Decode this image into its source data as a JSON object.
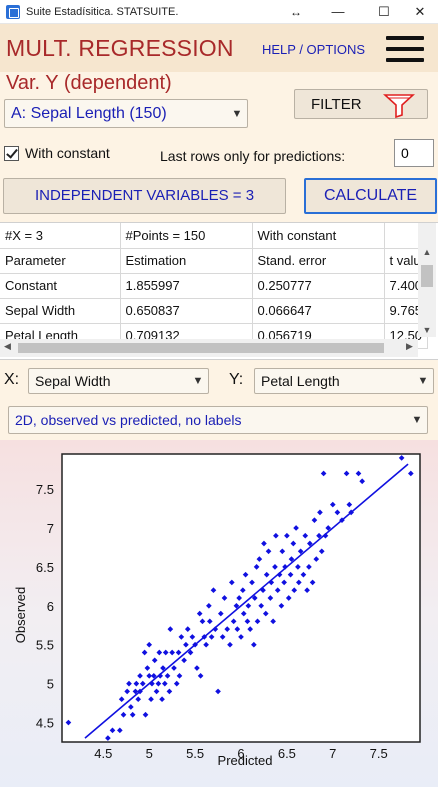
{
  "window": {
    "title": "Suite Estadísitica. STATSUITE.",
    "controls": {
      "resize": "↔",
      "minimize": "—",
      "maximize": "☐",
      "close": "✕"
    }
  },
  "header": {
    "title": "MULT. REGRESSION",
    "help": "HELP / OPTIONS"
  },
  "var_y": {
    "label": "Var. Y (dependent)",
    "selected": "A: Sepal Length (150)"
  },
  "filter_button": "FILTER",
  "with_constant": {
    "label": "With constant",
    "checked": true
  },
  "last_rows": {
    "label": "Last rows only for predictions:",
    "value": "0"
  },
  "independent_button": "INDEPENDENT VARIABLES = 3",
  "calculate_button": "CALCULATE",
  "results_table": {
    "rows": [
      [
        "#X = 3",
        "#Points = 150",
        "With constant",
        ""
      ],
      [
        "Parameter",
        "Estimation",
        "Stand. error",
        "t valu"
      ],
      [
        "Constant",
        "1.855997",
        "0.250777",
        "7.400"
      ],
      [
        "Sepal Width",
        "0.650837",
        "0.066647",
        "9.765"
      ],
      [
        "Petal Length",
        "0.709132",
        "0.056719",
        "12.50"
      ]
    ]
  },
  "x_select": {
    "label": "X:",
    "selected": "Sepal Width"
  },
  "y_select": {
    "label": "Y:",
    "selected": "Petal Length"
  },
  "plot_type": {
    "selected": "2D, observed vs predicted, no labels"
  },
  "colors": {
    "accent_red": "#a8292a",
    "link_blue": "#1a1fb5",
    "point_blue": "#1010e0"
  },
  "icons": [
    "funnel-icon",
    "hamburger-icon",
    "chevron-down-icon",
    "checkbox-checked-icon"
  ],
  "chart_data": {
    "type": "scatter",
    "xlabel": "Predicted",
    "ylabel": "Observed",
    "xlim": [
      4.05,
      7.95
    ],
    "ylim": [
      4.25,
      7.95
    ],
    "xticks": [
      "4.5",
      "5",
      "5.5",
      "6",
      "6.5",
      "7",
      "7.5"
    ],
    "yticks": [
      "4.5",
      "5",
      "5.5",
      "6",
      "6.5",
      "7",
      "7.5"
    ],
    "grid": true,
    "fit_line": {
      "x": [
        4.3,
        7.82
      ],
      "y": [
        4.3,
        7.82
      ]
    },
    "points": [
      [
        4.12,
        4.5
      ],
      [
        4.55,
        4.3
      ],
      [
        4.6,
        4.4
      ],
      [
        4.68,
        4.4
      ],
      [
        4.7,
        4.8
      ],
      [
        4.72,
        4.6
      ],
      [
        4.76,
        4.9
      ],
      [
        4.78,
        5.0
      ],
      [
        4.8,
        4.7
      ],
      [
        4.82,
        4.6
      ],
      [
        4.85,
        4.9
      ],
      [
        4.86,
        5.0
      ],
      [
        4.88,
        4.8
      ],
      [
        4.9,
        5.1
      ],
      [
        4.9,
        4.9
      ],
      [
        4.93,
        5.0
      ],
      [
        4.95,
        5.4
      ],
      [
        4.96,
        4.6
      ],
      [
        4.98,
        5.2
      ],
      [
        5.0,
        5.1
      ],
      [
        5.0,
        5.5
      ],
      [
        5.02,
        4.8
      ],
      [
        5.03,
        5.0
      ],
      [
        5.05,
        5.1
      ],
      [
        5.06,
        5.3
      ],
      [
        5.08,
        4.9
      ],
      [
        5.1,
        5.0
      ],
      [
        5.11,
        5.4
      ],
      [
        5.12,
        5.1
      ],
      [
        5.14,
        4.8
      ],
      [
        5.15,
        5.2
      ],
      [
        5.17,
        5.0
      ],
      [
        5.18,
        5.4
      ],
      [
        5.2,
        5.1
      ],
      [
        5.22,
        4.9
      ],
      [
        5.23,
        5.7
      ],
      [
        5.25,
        5.4
      ],
      [
        5.27,
        5.2
      ],
      [
        5.3,
        5.0
      ],
      [
        5.32,
        5.4
      ],
      [
        5.33,
        5.1
      ],
      [
        5.35,
        5.6
      ],
      [
        5.38,
        5.3
      ],
      [
        5.4,
        5.5
      ],
      [
        5.42,
        5.7
      ],
      [
        5.45,
        5.4
      ],
      [
        5.47,
        5.6
      ],
      [
        5.5,
        5.5
      ],
      [
        5.52,
        5.2
      ],
      [
        5.55,
        5.9
      ],
      [
        5.56,
        5.1
      ],
      [
        5.58,
        5.8
      ],
      [
        5.6,
        5.6
      ],
      [
        5.62,
        5.5
      ],
      [
        5.65,
        6.0
      ],
      [
        5.66,
        5.8
      ],
      [
        5.68,
        5.6
      ],
      [
        5.7,
        6.2
      ],
      [
        5.72,
        5.7
      ],
      [
        5.75,
        4.9
      ],
      [
        5.78,
        5.9
      ],
      [
        5.8,
        5.6
      ],
      [
        5.82,
        6.1
      ],
      [
        5.85,
        5.7
      ],
      [
        5.88,
        5.5
      ],
      [
        5.9,
        6.3
      ],
      [
        5.92,
        5.8
      ],
      [
        5.95,
        6.0
      ],
      [
        5.96,
        5.7
      ],
      [
        5.98,
        6.1
      ],
      [
        6.0,
        5.6
      ],
      [
        6.02,
        6.2
      ],
      [
        6.03,
        5.9
      ],
      [
        6.05,
        6.4
      ],
      [
        6.07,
        5.8
      ],
      [
        6.08,
        6.0
      ],
      [
        6.1,
        5.7
      ],
      [
        6.12,
        6.3
      ],
      [
        6.14,
        5.5
      ],
      [
        6.15,
        6.1
      ],
      [
        6.17,
        6.5
      ],
      [
        6.18,
        5.8
      ],
      [
        6.2,
        6.6
      ],
      [
        6.22,
        6.0
      ],
      [
        6.24,
        6.2
      ],
      [
        6.25,
        6.8
      ],
      [
        6.27,
        5.9
      ],
      [
        6.28,
        6.4
      ],
      [
        6.3,
        6.7
      ],
      [
        6.32,
        6.1
      ],
      [
        6.33,
        6.3
      ],
      [
        6.35,
        5.8
      ],
      [
        6.37,
        6.5
      ],
      [
        6.38,
        6.9
      ],
      [
        6.4,
        6.2
      ],
      [
        6.42,
        6.4
      ],
      [
        6.44,
        6.0
      ],
      [
        6.45,
        6.7
      ],
      [
        6.47,
        6.3
      ],
      [
        6.48,
        6.5
      ],
      [
        6.5,
        6.9
      ],
      [
        6.52,
        6.1
      ],
      [
        6.54,
        6.4
      ],
      [
        6.55,
        6.6
      ],
      [
        6.57,
        6.8
      ],
      [
        6.58,
        6.2
      ],
      [
        6.6,
        7.0
      ],
      [
        6.62,
        6.5
      ],
      [
        6.63,
        6.3
      ],
      [
        6.65,
        6.7
      ],
      [
        6.68,
        6.4
      ],
      [
        6.7,
        6.9
      ],
      [
        6.72,
        6.2
      ],
      [
        6.74,
        6.5
      ],
      [
        6.75,
        6.8
      ],
      [
        6.78,
        6.3
      ],
      [
        6.8,
        7.1
      ],
      [
        6.82,
        6.6
      ],
      [
        6.85,
        6.9
      ],
      [
        6.86,
        7.2
      ],
      [
        6.88,
        6.7
      ],
      [
        6.9,
        7.7
      ],
      [
        6.92,
        6.9
      ],
      [
        6.95,
        7.0
      ],
      [
        7.0,
        7.3
      ],
      [
        7.05,
        7.2
      ],
      [
        7.1,
        7.1
      ],
      [
        7.15,
        7.7
      ],
      [
        7.18,
        7.3
      ],
      [
        7.2,
        7.2
      ],
      [
        7.28,
        7.7
      ],
      [
        7.32,
        7.6
      ],
      [
        7.75,
        7.9
      ],
      [
        7.85,
        7.7
      ]
    ]
  }
}
